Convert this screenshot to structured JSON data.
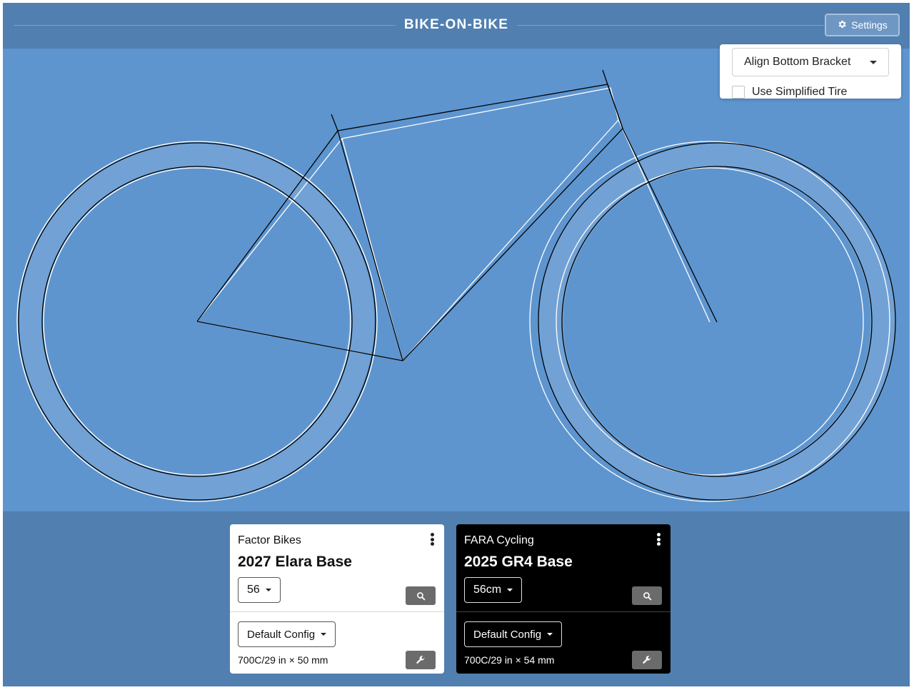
{
  "header": {
    "title": "BIKE-ON-BIKE",
    "settings_label": "Settings"
  },
  "settings_panel": {
    "alignment_selected": "Align Bottom Bracket",
    "simplified_tire_label": "Use Simplified Tire",
    "simplified_tire_checked": false
  },
  "canvas": {
    "background": "#5e95cf",
    "bike_a_stroke": "#000000",
    "bike_b_stroke": "#ffffff"
  },
  "bikes": [
    {
      "brand": "Factor Bikes",
      "model": "2027 Elara Base",
      "size": "56",
      "config": "Default Config",
      "tire": "700C/29 in × 50 mm",
      "theme": "light"
    },
    {
      "brand": "FARA Cycling",
      "model": "2025 GR4 Base",
      "size": "56cm",
      "config": "Default Config",
      "tire": "700C/29 in × 54 mm",
      "theme": "dark"
    }
  ],
  "icons": {
    "settings": "gear-icon",
    "menu": "more-vertical-icon",
    "search": "search-icon",
    "config": "wrench-icon",
    "dropdown": "caret-down-icon"
  }
}
